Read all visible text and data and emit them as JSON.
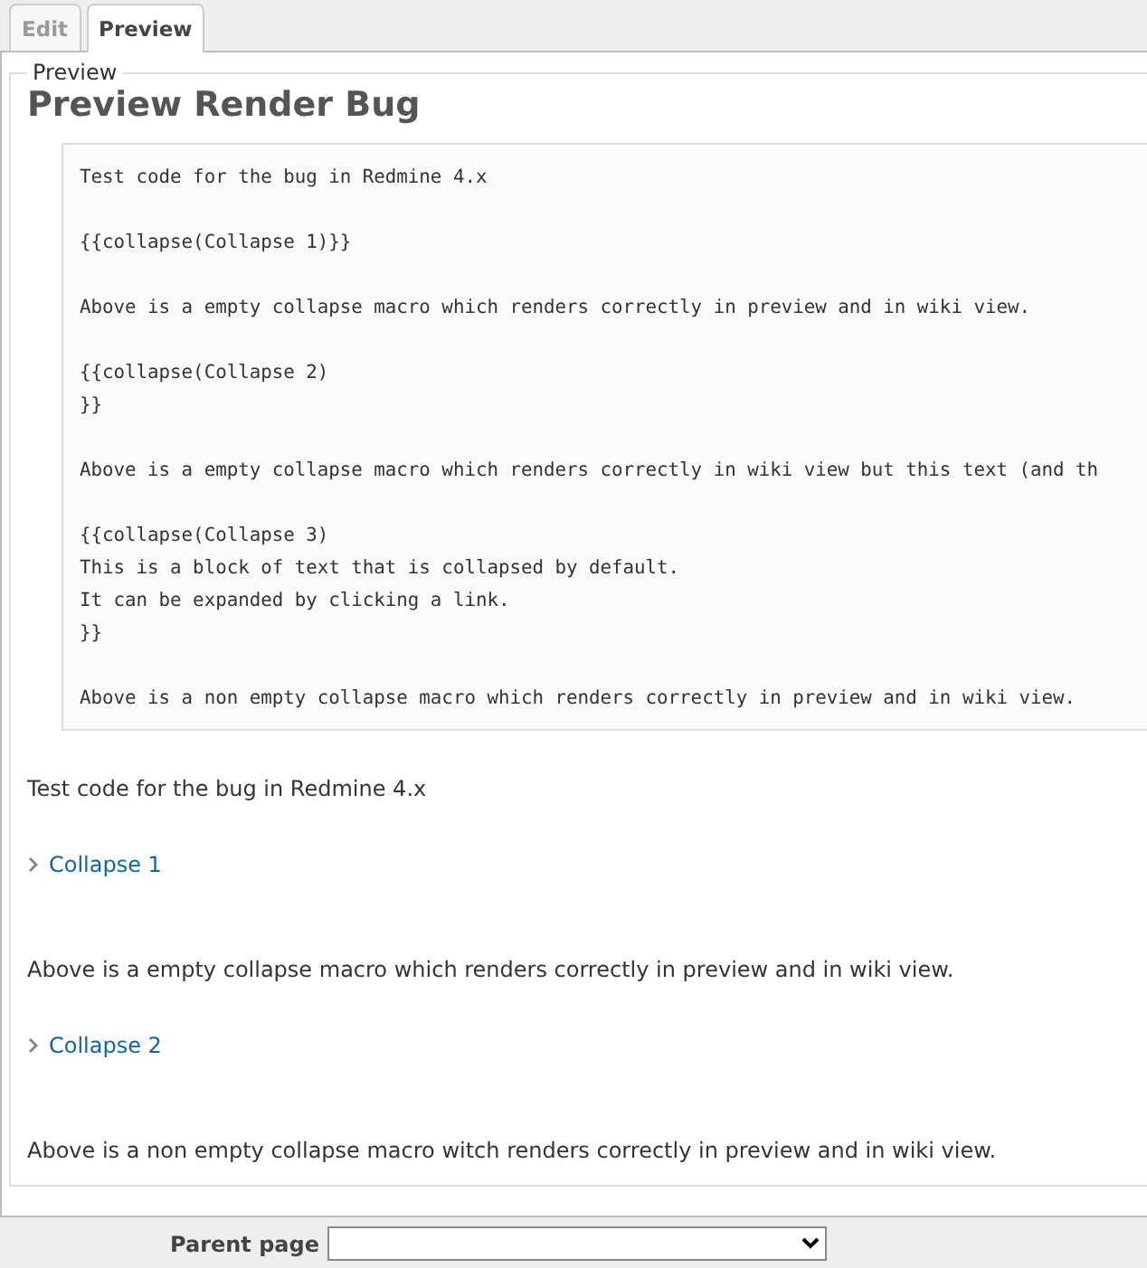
{
  "tabs": [
    {
      "label": "Edit",
      "selected": false
    },
    {
      "label": "Preview",
      "selected": true
    }
  ],
  "preview": {
    "legend": "Preview",
    "heading": "Preview Render Bug",
    "code_block": [
      [
        "Test code for the bug in Redmine 4.x"
      ],
      [
        "{{collapse(Collapse 1)}}"
      ],
      [
        "Above is a empty collapse macro which renders correctly in preview and in wiki view."
      ],
      [
        "{{collapse(Collapse 2)",
        "}}"
      ],
      [
        "Above is a empty collapse macro which renders correctly in wiki view but this text (and th"
      ],
      [
        "{{collapse(Collapse 3)",
        "This is a block of text that is collapsed by default.",
        "It can be expanded by clicking a link.",
        "}}"
      ],
      [
        "Above is a non empty collapse macro which renders correctly in preview and in wiki view."
      ]
    ],
    "content": [
      {
        "kind": "paragraph",
        "text": "Test code for the bug in Redmine 4.x"
      },
      {
        "kind": "collapse",
        "text": "Collapse 1"
      },
      {
        "kind": "paragraph",
        "text": "Above is a empty collapse macro which renders correctly in preview and in wiki view."
      },
      {
        "kind": "collapse",
        "text": "Collapse 2"
      },
      {
        "kind": "paragraph",
        "text": "Above is a non empty collapse macro witch renders correctly in preview and in wiki view."
      }
    ]
  },
  "parent_page": {
    "label": "Parent page"
  }
}
